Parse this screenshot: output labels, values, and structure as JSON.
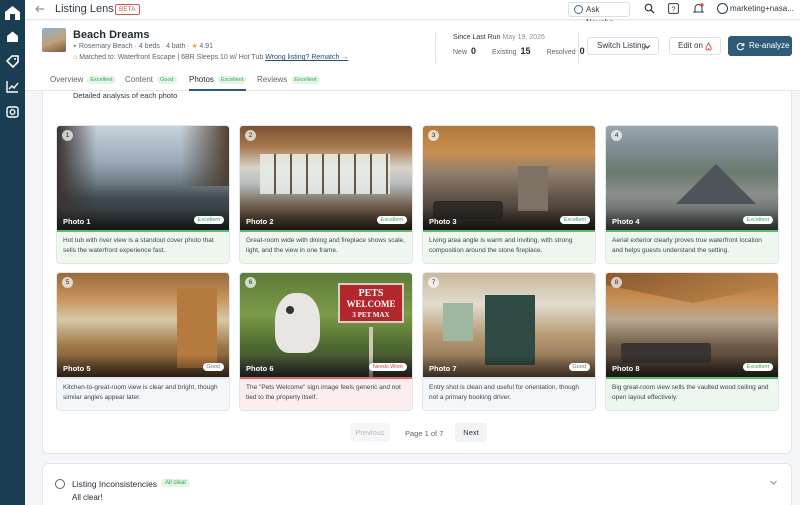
{
  "topbar": {
    "title": "Listing Lens",
    "beta": "BETA",
    "ask_label": "Ask Neyoba",
    "user": "marketing+nasa..."
  },
  "listing": {
    "title": "Beach Dreams",
    "location": "Rosemary Beach",
    "beds_baths": "· 4 beds · 4 bath ·",
    "rating": "4.91",
    "matched_prefix": "Matched to: Waterfront Escape | 6BR Sleeps 10 w/ Hot Tub",
    "rematch_link": "Wrong listing? Rematch →"
  },
  "since": {
    "label": "Since Last Run",
    "date": "May 19, 2026",
    "new_label": "New",
    "new_value": "0",
    "existing_label": "Existing",
    "existing_value": "15",
    "resolved_label": "Resolved",
    "resolved_value": "0"
  },
  "actions": {
    "switch": "Switch Listing",
    "edit_on": "Edit on",
    "reanalyze": "Re-analyze"
  },
  "tabs": [
    {
      "label": "Overview",
      "badge": "Excellent"
    },
    {
      "label": "Content",
      "badge": "Good"
    },
    {
      "label": "Photos",
      "badge": "Excellent"
    },
    {
      "label": "Reviews",
      "badge": "Excellent"
    }
  ],
  "photos_section": {
    "subtitle": "Detailed analysis of each photo",
    "photos": [
      {
        "num": "1",
        "name": "Photo 1",
        "rating": "Excellent",
        "desc": "Hot tub with river view is a standout cover photo that sells the waterfront experience fast."
      },
      {
        "num": "2",
        "name": "Photo 2",
        "rating": "Excellent",
        "desc": "Great-room wide with dining and fireplace shows scale, light, and the view in one frame."
      },
      {
        "num": "3",
        "name": "Photo 3",
        "rating": "Excellent",
        "desc": "Living area angle is warm and inviting, with strong composition around the stone fireplace."
      },
      {
        "num": "4",
        "name": "Photo 4",
        "rating": "Excellent",
        "desc": "Aerial exterior clearly proves true waterfront location and helps guests understand the setting."
      },
      {
        "num": "5",
        "name": "Photo 5",
        "rating": "Good",
        "desc": "Kitchen-to-great-room view is clear and bright, though similar angles appear later."
      },
      {
        "num": "6",
        "name": "Photo 6",
        "rating": "Needs Work",
        "desc": "The \"Pets Welcome\" sign image feels generic and not tied to the property itself.",
        "sign_line1": "PETS",
        "sign_line2": "WELCOME",
        "sign_line3": "3 PET MAX"
      },
      {
        "num": "7",
        "name": "Photo 7",
        "rating": "Good",
        "desc": "Entry shot is clean and useful for orientation, though not a primary booking driver."
      },
      {
        "num": "8",
        "name": "Photo 8",
        "rating": "Excellent",
        "desc": "Big great-room view sells the vaulted wood ceiling and open layout effectively."
      }
    ],
    "pager": {
      "prev": "Previous",
      "status": "Page 1 of 7",
      "next": "Next"
    }
  },
  "inconsistencies": {
    "title": "Listing Inconsistencies",
    "badge": "All clear",
    "text": "All clear!"
  }
}
